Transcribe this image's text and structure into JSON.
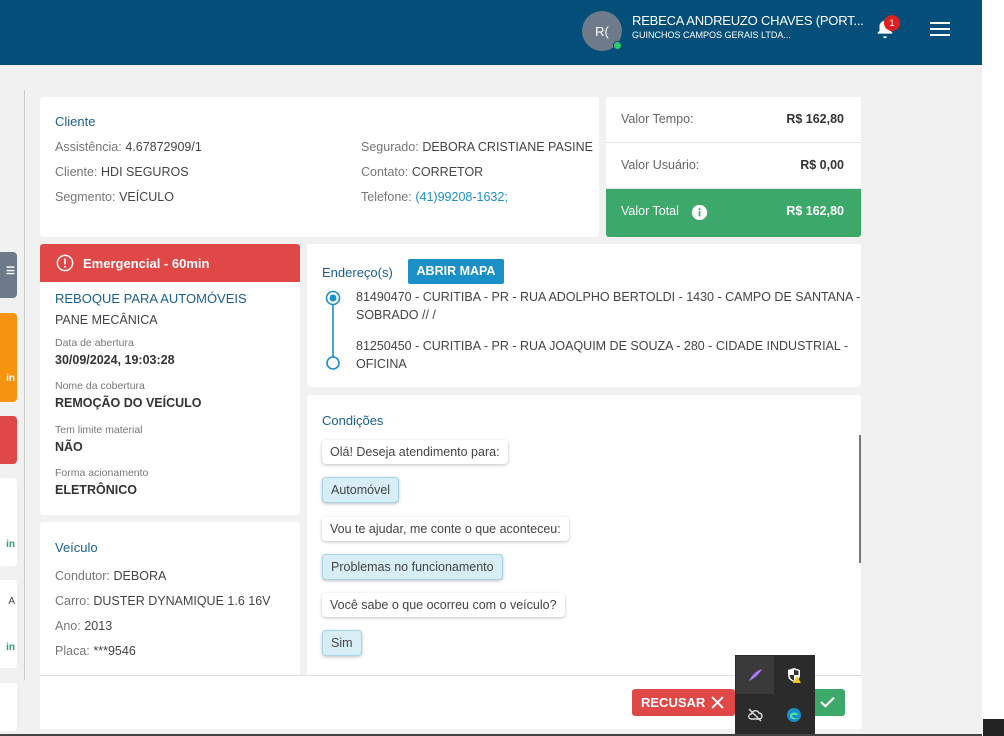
{
  "header": {
    "avatar_initials": "R(",
    "user_name": "REBECA ANDREUZO CHAVES (PORT...",
    "company": "GUINCHOS CAMPOS GERAIS LTDA...",
    "notification_count": "1"
  },
  "client": {
    "title": "Cliente",
    "assistencia_label": "Assistência:",
    "assistencia_value": "4.67872909/1",
    "cliente_label": "Cliente:",
    "cliente_value": "HDI SEGUROS",
    "segmento_label": "Segmento:",
    "segmento_value": "VEÍCULO",
    "segurado_label": "Segurado:",
    "segurado_value": "DEBORA CRISTIANE PASINE",
    "contato_label": "Contato:",
    "contato_value": "CORRETOR",
    "telefone_label": "Telefone:",
    "telefone_value": "(41)99208-1632;"
  },
  "values": {
    "tempo_label": "Valor Tempo:",
    "tempo_value": "R$ 162,80",
    "usuario_label": "Valor Usuário:",
    "usuario_value": "R$ 0,00",
    "total_label": "Valor Total",
    "total_value": "R$ 162,80"
  },
  "service": {
    "badge": "Emergencial - 60min",
    "type": "REBOQUE PARA AUTOMÓVEIS",
    "problem": "PANE MECÂNICA",
    "abertura_label": "Data de abertura",
    "abertura_value": "30/09/2024, 19:03:28",
    "cobertura_label": "Nome da cobertura",
    "cobertura_value": "REMOÇÃO DO VEÍCULO",
    "limite_label": "Tem limite material",
    "limite_value": "NÃO",
    "acionamento_label": "Forma acionamento",
    "acionamento_value": "ELETRÔNICO"
  },
  "vehicle": {
    "title": "Veículo",
    "condutor_label": "Condutor:",
    "condutor_value": "DEBORA",
    "carro_label": "Carro:",
    "carro_value": "DUSTER DYNAMIQUE 1.6 16V",
    "ano_label": "Ano:",
    "ano_value": "2013",
    "placa_label": "Placa:",
    "placa_value": "***9546"
  },
  "address": {
    "title": "Endereço(s)",
    "map_button": "ABRIR MAPA",
    "origin_line1": "81490470 - CURITIBA - PR - RUA ADOLPHO BERTOLDI - 1430 - CAMPO DE SANTANA -",
    "origin_line2": "SOBRADO // /",
    "dest_line1": "81250450 - CURITIBA - PR - RUA JOAQUIM DE SOUZA - 280 - CIDADE INDUSTRIAL -",
    "dest_line2": "OFICINA"
  },
  "conditions": {
    "title": "Condições",
    "messages": [
      "Olá! Deseja atendimento para:",
      "Automóvel",
      "Vou te ajudar, me conte o que aconteceu:",
      "Problemas no funcionamento",
      "Você sabe o que ocorreu com o veículo?",
      "Sim"
    ]
  },
  "sidebar_cards": {
    "partial_1": "in",
    "partial_2": "in",
    "partial_3": "A",
    "partial_4": "in"
  },
  "actions": {
    "recusar": "RECUSAR"
  },
  "colors": {
    "header": "#044f79",
    "accent_blue": "#1b8fc8",
    "danger": "#e04848",
    "success": "#3ca86a"
  }
}
